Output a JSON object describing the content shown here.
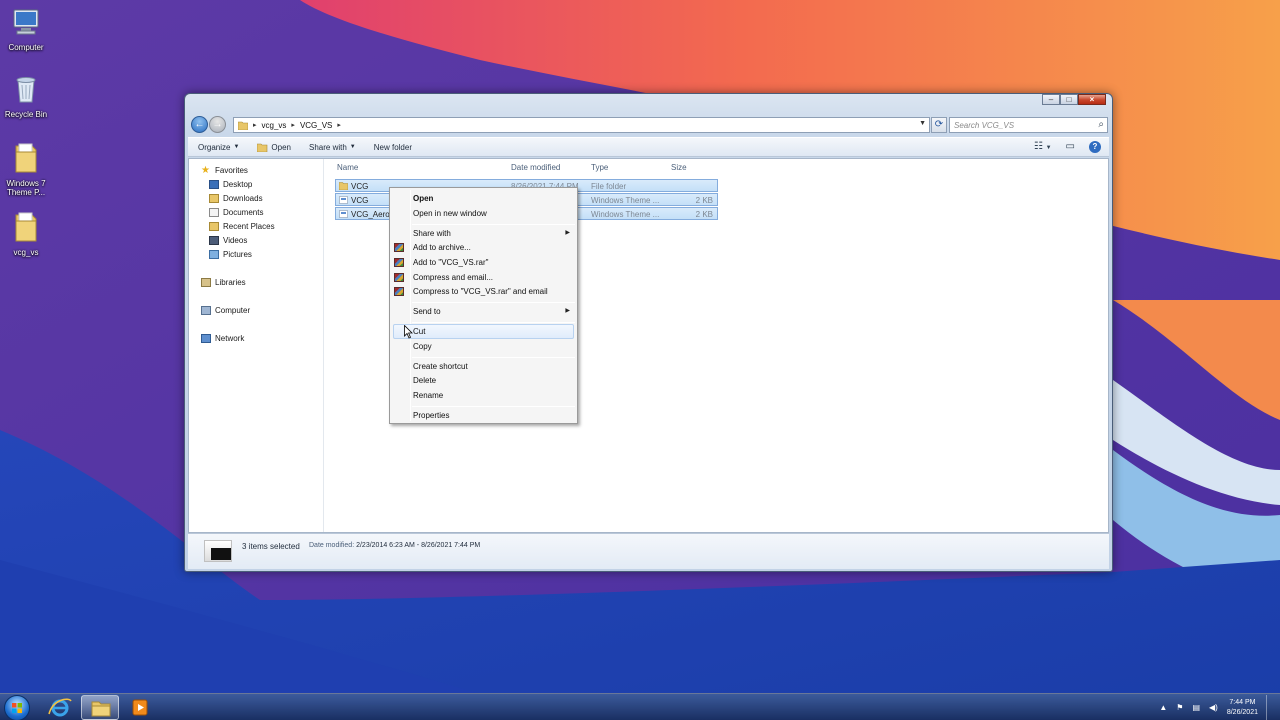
{
  "desktop": {
    "icons": [
      {
        "label": "Computer"
      },
      {
        "label": "Recycle Bin"
      },
      {
        "label": "Windows 7 Theme P..."
      },
      {
        "label": "vcg_vs"
      }
    ]
  },
  "window": {
    "address": {
      "segments": [
        "vcg_vs",
        "VCG_VS"
      ]
    },
    "search_placeholder": "Search VCG_VS",
    "toolbar": {
      "organize": "Organize",
      "open": "Open",
      "share_with": "Share with",
      "new_folder": "New folder"
    },
    "nav_pane": {
      "favorites": "Favorites",
      "favorite_items": [
        "Desktop",
        "Downloads",
        "Documents",
        "Recent Places",
        "Videos",
        "Pictures"
      ],
      "libraries": "Libraries",
      "computer": "Computer",
      "network": "Network"
    },
    "columns": {
      "name": "Name",
      "date_modified": "Date modified",
      "type": "Type",
      "size": "Size"
    },
    "files": [
      {
        "name": "VCG",
        "date": "8/26/2021 7:44 PM",
        "type": "File folder",
        "size": ""
      },
      {
        "name": "VCG",
        "date": "",
        "type": "Windows Theme ...",
        "size": "2 KB"
      },
      {
        "name": "VCG_Aero",
        "date": "",
        "type": "Windows Theme ...",
        "size": "2 KB"
      }
    ],
    "status": {
      "selected": "3 items selected",
      "date_label": "Date modified:",
      "date_range": "2/23/2014 6:23 AM - 8/26/2021 7:44 PM"
    }
  },
  "context_menu": {
    "open": "Open",
    "open_new_window": "Open in new window",
    "share_with": "Share with",
    "add_to_archive": "Add to archive...",
    "add_to_rar": "Add to \"VCG_VS.rar\"",
    "compress_email": "Compress and email...",
    "compress_rar_email": "Compress to \"VCG_VS.rar\" and email",
    "send_to": "Send to",
    "cut": "Cut",
    "copy": "Copy",
    "create_shortcut": "Create shortcut",
    "delete": "Delete",
    "rename": "Rename",
    "properties": "Properties"
  },
  "taskbar": {
    "clock_time": "7:44 PM",
    "clock_date": "8/26/2021"
  },
  "colors": {
    "selection_fill": "#cde6fb",
    "selection_border": "#84acdd",
    "menu_hover": "#e0ecfb"
  }
}
